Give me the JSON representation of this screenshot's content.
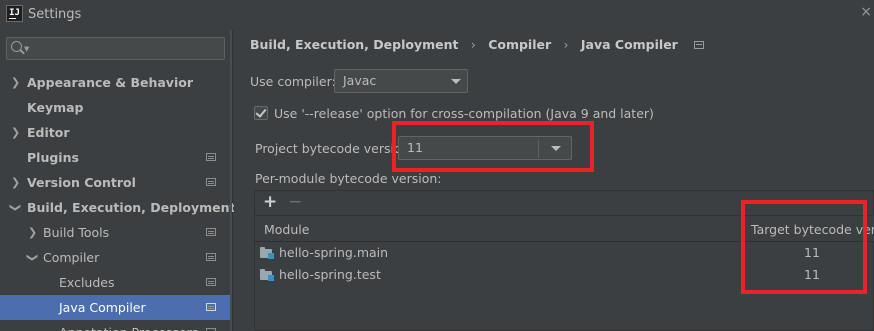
{
  "window": {
    "app_icon_text": "IJ",
    "title": "Settings",
    "close_glyph": "×"
  },
  "sidebar": {
    "search_placeholder": "",
    "items": [
      {
        "label": "Appearance & Behavior",
        "level": 0,
        "expandable": true,
        "expanded": false,
        "bold": true,
        "page_icon": false
      },
      {
        "label": "Keymap",
        "level": 0,
        "expandable": false,
        "bold": true,
        "page_icon": false
      },
      {
        "label": "Editor",
        "level": 0,
        "expandable": true,
        "expanded": false,
        "bold": true,
        "page_icon": false
      },
      {
        "label": "Plugins",
        "level": 0,
        "expandable": false,
        "bold": true,
        "page_icon": true
      },
      {
        "label": "Version Control",
        "level": 0,
        "expandable": true,
        "expanded": false,
        "bold": true,
        "page_icon": true
      },
      {
        "label": "Build, Execution, Deployment",
        "level": 0,
        "expandable": true,
        "expanded": true,
        "bold": true,
        "page_icon": false
      },
      {
        "label": "Build Tools",
        "level": 1,
        "expandable": true,
        "expanded": false,
        "bold": false,
        "page_icon": true
      },
      {
        "label": "Compiler",
        "level": 1,
        "expandable": true,
        "expanded": true,
        "bold": false,
        "page_icon": true
      },
      {
        "label": "Excludes",
        "level": 2,
        "expandable": false,
        "bold": false,
        "page_icon": true
      },
      {
        "label": "Java Compiler",
        "level": 2,
        "expandable": false,
        "bold": false,
        "page_icon": true,
        "selected": true
      },
      {
        "label": "Annotation Processors",
        "level": 2,
        "expandable": false,
        "bold": false,
        "page_icon": true
      }
    ]
  },
  "breadcrumb": {
    "items": [
      "Build, Execution, Deployment",
      "Compiler",
      "Java Compiler"
    ],
    "separator": "›"
  },
  "settings": {
    "use_compiler_label": "Use compiler:",
    "use_compiler_value": "Javac",
    "release_option_label": "Use '--release' option for cross-compilation (Java 9 and later)",
    "release_option_checked": true,
    "project_bytecode_label": "Project bytecode version:",
    "project_bytecode_value": "11",
    "per_module_label": "Per-module bytecode version:"
  },
  "table": {
    "add_glyph": "+",
    "remove_glyph": "−",
    "columns": [
      "Module",
      "Target bytecode versio"
    ],
    "rows": [
      {
        "module": "hello-spring.main",
        "target": "11"
      },
      {
        "module": "hello-spring.test",
        "target": "11"
      }
    ]
  },
  "colors": {
    "highlight": "#e8242a",
    "selection": "#4b6eaf",
    "background": "#3c3f41"
  }
}
